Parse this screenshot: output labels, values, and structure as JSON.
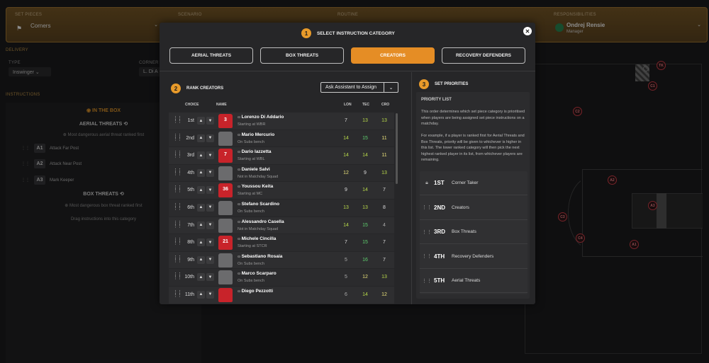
{
  "topbar": {
    "set_pieces_label": "SET PIECES",
    "set_pieces_value": "Corners",
    "scenario_label": "SCENARIO",
    "routine_label": "ROUTINE",
    "responsibilities_label": "RESPONSIBILITIES",
    "manager_name": "Ondrej Rensie",
    "manager_role": "Manager"
  },
  "background": {
    "delivery_label": "DELIVERY",
    "type_label": "TYPE",
    "type_value": "Inswinger",
    "corner_taker_label": "CORNER T",
    "corner_taker_value": "L. Di A",
    "instructions_label": "INSTRUCTIONS",
    "in_the_box": "IN THE BOX",
    "aerial_threats": "AERIAL THREATS",
    "aerial_desc": "Most dangerous aerial threat ranked first",
    "aerial_items": [
      {
        "badge": "A1",
        "label": "Attack Far Post"
      },
      {
        "badge": "A2",
        "label": "Attack Near Post"
      },
      {
        "badge": "A3",
        "label": "Mark Keeper"
      }
    ],
    "box_threats": "BOX THREATS",
    "box_desc": "Most dangerous box threat ranked first",
    "drag_hint": "Drag instructions into this category"
  },
  "pitch_markers": [
    "TK",
    "C1",
    "C2",
    "A2",
    "A3",
    "C3",
    "C4",
    "A1"
  ],
  "modal": {
    "step1": "1",
    "title": "SELECT INSTRUCTION CATEGORY",
    "categories": [
      "AERIAL THREATS",
      "BOX THREATS",
      "CREATORS",
      "RECOVERY DEFENDERS"
    ],
    "active_category": "CREATORS",
    "step2": "2",
    "rank_title": "RANK CREATORS",
    "assist_label": "Ask Assistant to Assign",
    "columns": {
      "choice": "CHOICE",
      "name": "NAME",
      "lon": "LON",
      "tec": "TEC",
      "cro": "CRO"
    },
    "players": [
      {
        "rank": "1st",
        "name": "Lorenzo Di Addario",
        "status": "Starting at WBR",
        "shirt": "red",
        "num": "3",
        "lon": "7",
        "tec": "13",
        "cro": "13"
      },
      {
        "rank": "2nd",
        "name": "Mario Mercurio",
        "status": "On Subs bench",
        "shirt": "grey",
        "num": "",
        "lon": "14",
        "tec": "15",
        "cro": "11"
      },
      {
        "rank": "3rd",
        "name": "Dario Iazzetta",
        "status": "Starting at WBL",
        "shirt": "red",
        "num": "7",
        "lon": "14",
        "tec": "14",
        "cro": "11"
      },
      {
        "rank": "4th",
        "name": "Daniele Salvi",
        "status": "Not in Matchday Squad",
        "shirt": "grey",
        "num": "",
        "lon": "12",
        "tec": "9",
        "cro": "13"
      },
      {
        "rank": "5th",
        "name": "Youssou Keita",
        "status": "Starting at MC",
        "shirt": "red",
        "num": "36",
        "lon": "9",
        "tec": "14",
        "cro": "7"
      },
      {
        "rank": "6th",
        "name": "Stefano Scardino",
        "status": "On Subs bench",
        "shirt": "grey",
        "num": "",
        "lon": "13",
        "tec": "13",
        "cro": "8"
      },
      {
        "rank": "7th",
        "name": "Alessandro Casella",
        "status": "Not in Matchday Squad",
        "shirt": "grey",
        "num": "",
        "lon": "14",
        "tec": "15",
        "cro": "4"
      },
      {
        "rank": "8th",
        "name": "Michele Cincilla",
        "status": "Starting at STCR",
        "shirt": "red",
        "num": "21",
        "lon": "7",
        "tec": "15",
        "cro": "7"
      },
      {
        "rank": "9th",
        "name": "Sebastiano Rosaia",
        "status": "On Subs bench",
        "shirt": "grey",
        "num": "",
        "lon": "5",
        "tec": "16",
        "cro": "7"
      },
      {
        "rank": "10th",
        "name": "Marco Scarparo",
        "status": "On Subs bench",
        "shirt": "grey",
        "num": "",
        "lon": "5",
        "tec": "12",
        "cro": "13"
      },
      {
        "rank": "11th",
        "name": "Diego Pezzotti",
        "status": "",
        "shirt": "red",
        "num": "",
        "lon": "6",
        "tec": "14",
        "cro": "12"
      }
    ],
    "step3": "3",
    "set_priorities": "SET PRIORITIES",
    "priority_list_label": "PRIORITY LIST",
    "desc1": "This order determines which set piece category is prioritised when players are being assigned set piece instructions on a matchday.",
    "desc2": "For example, if a player is ranked first for Aerial Threats and Box Threats, priority will be given to whichever is higher in this list. The lower ranked category will then pick the next highest ranked player in its list, from whichever players are remaining.",
    "priorities": [
      {
        "ord": "1ST",
        "name": "Corner Taker",
        "locked": true
      },
      {
        "ord": "2ND",
        "name": "Creators",
        "locked": false
      },
      {
        "ord": "3RD",
        "name": "Box Threats",
        "locked": false
      },
      {
        "ord": "4TH",
        "name": "Recovery Defenders",
        "locked": false
      },
      {
        "ord": "5TH",
        "name": "Aerial Threats",
        "locked": false
      }
    ]
  }
}
